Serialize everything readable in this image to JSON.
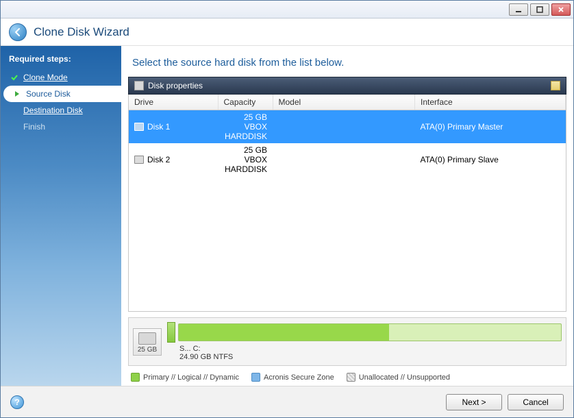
{
  "header": {
    "title": "Clone Disk Wizard"
  },
  "sidebar": {
    "title": "Required steps:",
    "items": [
      {
        "label": "Clone Mode",
        "state": "done"
      },
      {
        "label": "Source Disk",
        "state": "active"
      },
      {
        "label": "Destination Disk",
        "state": "pending"
      },
      {
        "label": "Finish",
        "state": "disabled"
      }
    ]
  },
  "main": {
    "instruction": "Select the source hard disk from the list below.",
    "disk_properties_label": "Disk properties",
    "columns": {
      "drive": "Drive",
      "capacity": "Capacity",
      "model": "Model",
      "interface": "Interface"
    },
    "disks": [
      {
        "drive": "Disk 1",
        "capacity": "25 GB",
        "model": "VBOX HARDDISK",
        "interface": "ATA(0) Primary Master",
        "selected": true
      },
      {
        "drive": "Disk 2",
        "capacity": "25 GB",
        "model": "VBOX HARDDISK",
        "interface": "ATA(0) Primary Slave",
        "selected": false
      }
    ],
    "selected_disk_panel": {
      "total": "25 GB",
      "partition_letter": "S...",
      "partition_label": "C:",
      "partition_info": "24.90 GB  NTFS"
    },
    "legend": {
      "primary": "Primary // Logical // Dynamic",
      "secure": "Acronis Secure Zone",
      "unalloc": "Unallocated // Unsupported"
    }
  },
  "footer": {
    "next": "Next >",
    "cancel": "Cancel"
  }
}
